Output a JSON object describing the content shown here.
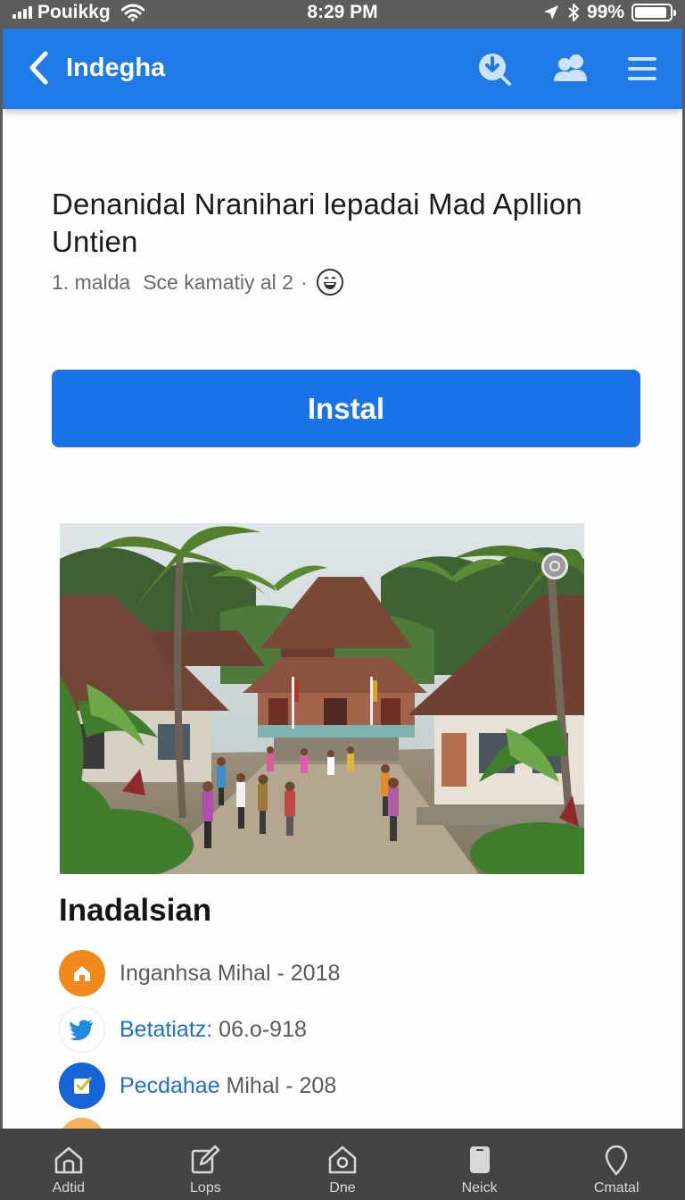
{
  "status_bar": {
    "carrier": "Pouikkg",
    "time": "8:29 PM",
    "battery_percent": "99%",
    "battery_level": 0.92
  },
  "nav": {
    "title": "Indegha",
    "back_icon": "chevron-left-icon",
    "actions": [
      "download-icon",
      "people-icon",
      "menu-icon"
    ],
    "color": "#1f7ae8"
  },
  "app": {
    "title": "Denanidal Nranihari lepadai Mad Apllion Untien",
    "meta_left": "1. malda",
    "meta_right": "Sce kamatiy al 2",
    "meta_separator": "·",
    "rating_icon": "grinning-face-icon"
  },
  "install_button": {
    "label": "Instal",
    "color": "#1a73e8"
  },
  "hero": {
    "icon": "location-pin-icon"
  },
  "section": {
    "title": "Inadalsian",
    "rows": [
      {
        "icon": "home-icon",
        "icon_color": "#f08a1c",
        "label": "",
        "value": "Inganhsa Mihal - 2018"
      },
      {
        "icon": "twitter-bird-icon",
        "icon_color": "#ffffff",
        "label": "Betatiatz:",
        "value": " 06.o-918"
      },
      {
        "icon": "checkbox-icon",
        "icon_color": "#1565d8",
        "label": "Pecdahae",
        "value": " Mihal - 208"
      }
    ]
  },
  "tab_bar": {
    "tabs": [
      {
        "label": "Adtid",
        "icon": "home-outline-icon"
      },
      {
        "label": "Lops",
        "icon": "edit-icon"
      },
      {
        "label": "Dne",
        "icon": "house-outline-icon"
      },
      {
        "label": "Neick",
        "icon": "phone-icon"
      },
      {
        "label": "Cmatal",
        "icon": "location-pin-icon"
      }
    ]
  }
}
